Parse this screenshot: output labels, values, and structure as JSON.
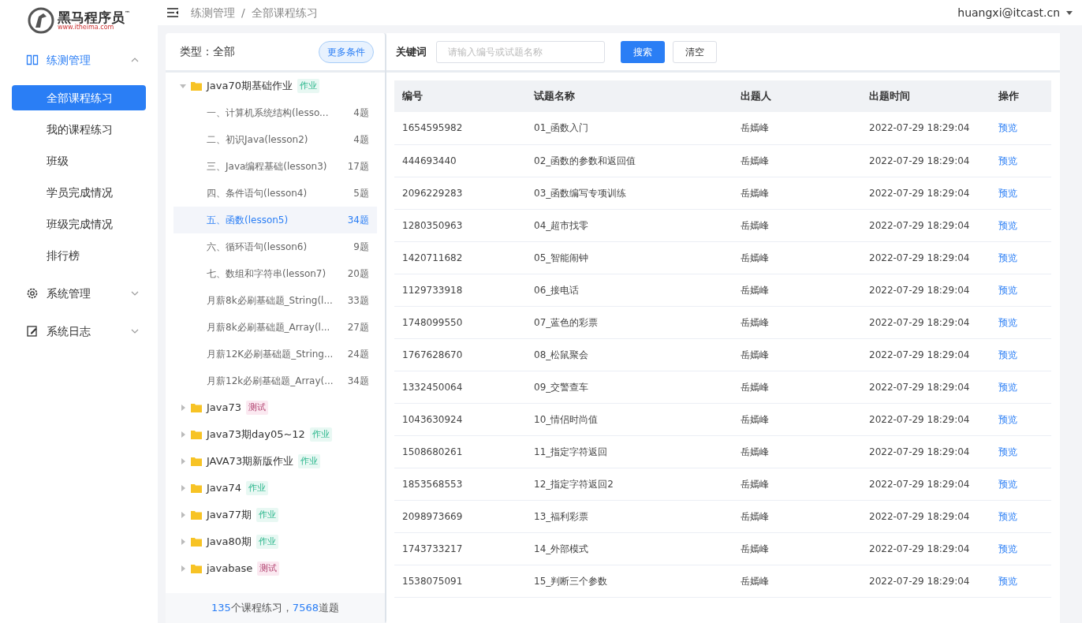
{
  "logo": {
    "name": "黑马程序员",
    "tm": "™",
    "url": "www.itheima.com"
  },
  "sidebar": {
    "items": [
      {
        "label": "练测管理",
        "kind": "book",
        "expanded": true,
        "children": [
          {
            "label": "全部课程练习",
            "selected": true
          },
          {
            "label": "我的课程练习",
            "selected": false
          },
          {
            "label": "班级",
            "selected": false
          },
          {
            "label": "学员完成情况",
            "selected": false
          },
          {
            "label": "班级完成情况",
            "selected": false
          },
          {
            "label": "排行榜",
            "selected": false
          }
        ]
      },
      {
        "label": "系统管理",
        "kind": "gear",
        "expanded": false
      },
      {
        "label": "系统日志",
        "kind": "log",
        "expanded": false
      }
    ]
  },
  "breadcrumb": [
    "练测管理",
    "/",
    "全部课程练习"
  ],
  "user": "huangxi@itcast.cn",
  "tree_panel": {
    "type_label": "类型：全部",
    "more_button": "更多条件",
    "courses": [
      {
        "name": "Java70期基础作业",
        "tag": {
          "text": "作业",
          "kind": "homework"
        },
        "expanded": true,
        "children": [
          {
            "name": "一、计算机系统结构(lesso...",
            "count": "4题",
            "selected": false
          },
          {
            "name": "二、初识Java(lesson2)",
            "count": "4题",
            "selected": false
          },
          {
            "name": "三、Java编程基础(lesson3)",
            "count": "17题",
            "selected": false
          },
          {
            "name": "四、条件语句(lesson4)",
            "count": "5题",
            "selected": false
          },
          {
            "name": "五、函数(lesson5)",
            "count": "34题",
            "selected": true
          },
          {
            "name": "六、循环语句(lesson6)",
            "count": "9题",
            "selected": false
          },
          {
            "name": "七、数组和字符串(lesson7)",
            "count": "20题",
            "selected": false
          },
          {
            "name": "月薪8k必刷基础题_String(l...",
            "count": "33题",
            "selected": false
          },
          {
            "name": "月薪8k必刷基础题_Array(l...",
            "count": "27题",
            "selected": false
          },
          {
            "name": "月薪12K必刷基础题_String...",
            "count": "24题",
            "selected": false
          },
          {
            "name": "月薪12k必刷基础题_Array(...",
            "count": "34题",
            "selected": false
          }
        ]
      },
      {
        "name": "Java73",
        "tag": {
          "text": "测试",
          "kind": "test"
        },
        "expanded": false
      },
      {
        "name": "Java73期day05~12",
        "tag": {
          "text": "作业",
          "kind": "homework"
        },
        "expanded": false
      },
      {
        "name": "JAVA73期新版作业",
        "tag": {
          "text": "作业",
          "kind": "homework"
        },
        "expanded": false
      },
      {
        "name": "Java74",
        "tag": {
          "text": "作业",
          "kind": "homework"
        },
        "expanded": false
      },
      {
        "name": "Java77期",
        "tag": {
          "text": "作业",
          "kind": "homework"
        },
        "expanded": false
      },
      {
        "name": "Java80期",
        "tag": {
          "text": "作业",
          "kind": "homework"
        },
        "expanded": false
      },
      {
        "name": "javabase",
        "tag": {
          "text": "测试",
          "kind": "test"
        },
        "expanded": false
      }
    ],
    "footer": "**135**个课程练习，**7568**道题"
  },
  "search": {
    "label": "关键词",
    "placeholder": "请输入编号或试题名称",
    "search_button": "搜索",
    "clear_button": "清空"
  },
  "table": {
    "columns": [
      "编号",
      "试题名称",
      "出题人",
      "出题时间",
      "操作"
    ],
    "rows": [
      [
        "1654595982",
        "01_函数入门",
        "岳嫣峰",
        "2022-07-29 18:29:04",
        "预览"
      ],
      [
        "444693440",
        "02_函数的参数和返回值",
        "岳嫣峰",
        "2022-07-29 18:29:04",
        "预览"
      ],
      [
        "2096229283",
        "03_函数编写专项训练",
        "岳嫣峰",
        "2022-07-29 18:29:04",
        "预览"
      ],
      [
        "1280350963",
        "04_超市找零",
        "岳嫣峰",
        "2022-07-29 18:29:04",
        "预览"
      ],
      [
        "1420711682",
        "05_智能闹钟",
        "岳嫣峰",
        "2022-07-29 18:29:04",
        "预览"
      ],
      [
        "1129733918",
        "06_接电话",
        "岳嫣峰",
        "2022-07-29 18:29:04",
        "预览"
      ],
      [
        "1748099550",
        "07_蓝色的彩票",
        "岳嫣峰",
        "2022-07-29 18:29:04",
        "预览"
      ],
      [
        "1767628670",
        "08_松鼠聚会",
        "岳嫣峰",
        "2022-07-29 18:29:04",
        "预览"
      ],
      [
        "1332450064",
        "09_交警查车",
        "岳嫣峰",
        "2022-07-29 18:29:04",
        "预览"
      ],
      [
        "1043630924",
        "10_情侣时尚值",
        "岳嫣峰",
        "2022-07-29 18:29:04",
        "预览"
      ],
      [
        "1508680261",
        "11_指定字符返回",
        "岳嫣峰",
        "2022-07-29 18:29:04",
        "预览"
      ],
      [
        "1853568553",
        "12_指定字符返回2",
        "岳嫣峰",
        "2022-07-29 18:29:04",
        "预览"
      ],
      [
        "2098973669",
        "13_福利彩票",
        "岳嫣峰",
        "2022-07-29 18:29:04",
        "预览"
      ],
      [
        "1743733217",
        "14_外部模式",
        "岳嫣峰",
        "2022-07-29 18:29:04",
        "预览"
      ],
      [
        "1538075091",
        "15_判断三个参数",
        "岳嫣峰",
        "2022-07-29 18:29:04",
        "预览"
      ]
    ]
  }
}
